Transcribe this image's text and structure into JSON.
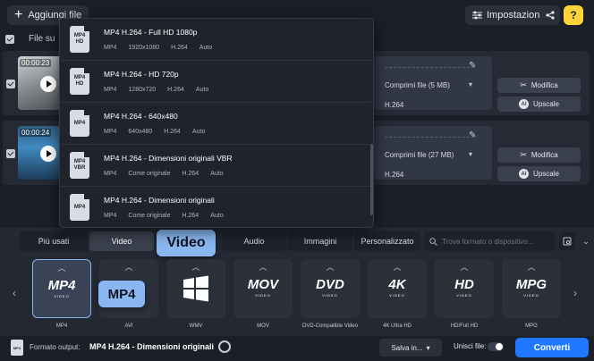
{
  "toolbar": {
    "add_files_label": "Aggiungi file",
    "settings_label": "Impostazioni",
    "help_label": "?"
  },
  "list_header": {
    "file_label": "File su"
  },
  "files": [
    {
      "duration": "00:00:23",
      "compress": "Comprimi file (5 MB)",
      "codec": "H.264",
      "edit_label": "Modifica",
      "upscale_label": "Upscale"
    },
    {
      "duration": "00:00:24",
      "compress": "Comprimi file (27 MB)",
      "codec": "H.264",
      "edit_label": "Modifica",
      "upscale_label": "Upscale"
    }
  ],
  "dropdown": {
    "items": [
      {
        "title": "MP4 H.264 - Full HD 1080p",
        "icon_line1": "MP4",
        "icon_line2": "HD",
        "meta": [
          "MP4",
          "1920x1080",
          "H.264",
          "Auto"
        ]
      },
      {
        "title": "MP4 H.264 - HD 720p",
        "icon_line1": "MP4",
        "icon_line2": "HD",
        "meta": [
          "MP4",
          "1280x720",
          "H.264",
          "Auto"
        ]
      },
      {
        "title": "MP4 H.264 - 640x480",
        "icon_line1": "MP4",
        "icon_line2": "",
        "meta": [
          "MP4",
          "640x480",
          "H.264",
          "Auto"
        ]
      },
      {
        "title": "MP4 H.264 - Dimensioni originali VBR",
        "icon_line1": "MP4",
        "icon_line2": "VBR",
        "meta": [
          "MP4",
          "Come originale",
          "H.264",
          "Auto"
        ]
      },
      {
        "title": "MP4 H.264 - Dimensioni originali",
        "icon_line1": "MP4",
        "icon_line2": "",
        "meta": [
          "MP4",
          "Come originale",
          "H.264",
          "Auto"
        ]
      }
    ]
  },
  "tabs": [
    {
      "label": "Più usati",
      "active": false
    },
    {
      "label": "Video",
      "active": true
    },
    {
      "label": "Audio",
      "active": false
    },
    {
      "label": "Immagini",
      "active": false
    },
    {
      "label": "Personalizzato",
      "active": false
    }
  ],
  "search": {
    "placeholder": "Trova formato o dispositivo..."
  },
  "tooltips": {
    "video_tab": "Video",
    "mp4_preset": "MP4"
  },
  "presets": [
    {
      "logo": "MP4",
      "logo_sub": "VIDEO",
      "label": "MP4",
      "active": true
    },
    {
      "logo": "",
      "logo_sub": "",
      "label": "AVI",
      "active": false
    },
    {
      "logo": "",
      "logo_sub": "",
      "label": "WMV",
      "active": false
    },
    {
      "logo": "MOV",
      "logo_sub": "VIDEO",
      "label": "MOV",
      "active": false
    },
    {
      "logo": "DVD",
      "logo_sub": "VIDEO",
      "label": "DVD-Compatible Video",
      "active": false
    },
    {
      "logo": "4K",
      "logo_sub": "VIDEO",
      "label": "4K Ultra HD",
      "active": false
    },
    {
      "logo": "HD",
      "logo_sub": "VIDEO",
      "label": "HD/Full HD",
      "active": false
    },
    {
      "logo": "MPG",
      "logo_sub": "VIDEO",
      "label": "MPG",
      "active": false
    }
  ],
  "footer": {
    "format_label": "Formato output:",
    "format_value": "MP4 H.264 - Dimensioni originali",
    "format_icon_text": "MP4",
    "save_label": "Salva in...",
    "merge_label": "Unisci file:",
    "convert_label": "Converti"
  },
  "colors": {
    "accent": "#1f78ff",
    "tooltip": "#8ab7f0",
    "help": "#ffd43b"
  }
}
